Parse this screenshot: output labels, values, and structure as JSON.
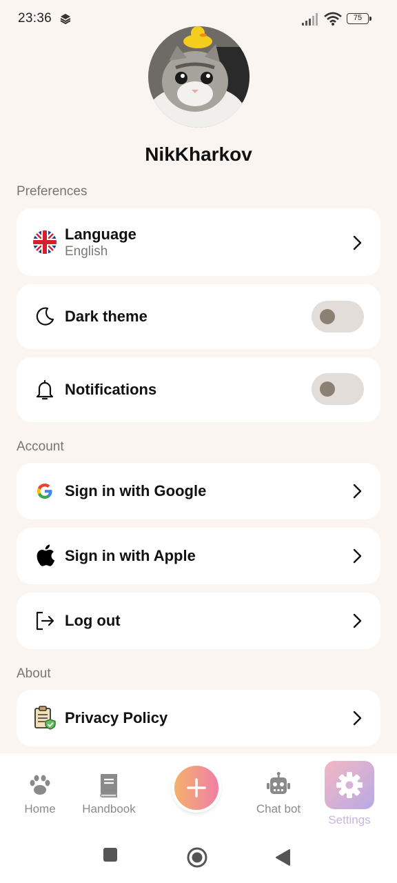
{
  "status_bar": {
    "time": "23:36",
    "battery": "75"
  },
  "profile": {
    "username": "NikKharkov"
  },
  "sections": {
    "preferences": "Preferences",
    "account": "Account",
    "about": "About"
  },
  "preferences": {
    "language": {
      "title": "Language",
      "value": "English"
    },
    "dark_theme": {
      "title": "Dark theme",
      "enabled": false
    },
    "notifications": {
      "title": "Notifications",
      "enabled": false
    }
  },
  "account": {
    "google": {
      "title": "Sign in with Google"
    },
    "apple": {
      "title": "Sign in with Apple"
    },
    "logout": {
      "title": "Log out"
    }
  },
  "about": {
    "privacy": {
      "title": "Privacy Policy"
    }
  },
  "bottom_nav": {
    "home": "Home",
    "handbook": "Handbook",
    "chatbot": "Chat bot",
    "settings": "Settings",
    "active": "Settings"
  },
  "colors": {
    "background": "#faf5f1",
    "card": "#ffffff",
    "toggle_track": "#e2ddd8",
    "toggle_knob": "#8b8074",
    "fab_gradient_start": "#f5b16b",
    "fab_gradient_end": "#f07ea6"
  }
}
